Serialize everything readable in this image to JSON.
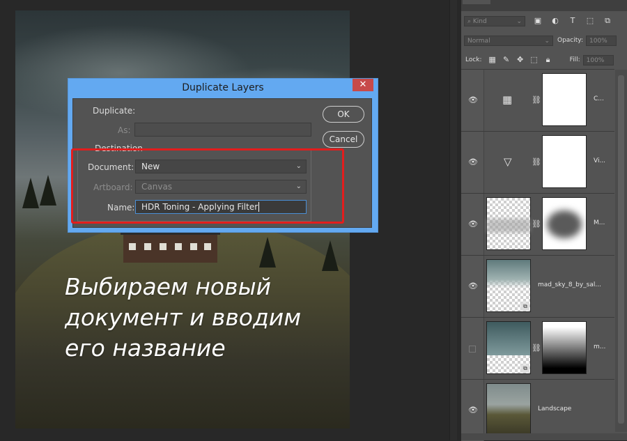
{
  "canvas": {
    "caption_lines": [
      "Выбираем новый",
      "документ и вводим",
      "его название"
    ]
  },
  "layers_panel": {
    "kind_filter": "Kind",
    "blend_mode": "Normal",
    "opacity_label": "Opacity:",
    "opacity_value": "100%",
    "lock_label": "Lock:",
    "fill_label": "Fill:",
    "fill_value": "100%",
    "layers": [
      {
        "name": "C...",
        "visible": true,
        "type": "channel-mixer-adjustment"
      },
      {
        "name": "Vi...",
        "visible": true,
        "type": "vibrance-adjustment"
      },
      {
        "name": "M...",
        "visible": true,
        "type": "masked-layer"
      },
      {
        "name": "mad_sky_8_by_sal...",
        "visible": true,
        "type": "smart-object"
      },
      {
        "name": "m...",
        "visible": false,
        "type": "smart-object-masked"
      },
      {
        "name": "Landscape",
        "visible": true,
        "type": "pixel-layer"
      }
    ]
  },
  "dialog": {
    "title": "Duplicate Layers",
    "close_label": "✕",
    "duplicate_label": "Duplicate:",
    "as_label": "As:",
    "as_value": "",
    "destination_label": "Destination",
    "document_label": "Document:",
    "document_value": "New",
    "artboard_label": "Artboard:",
    "artboard_value": "Canvas",
    "name_label": "Name:",
    "name_value": "HDR Toning - Applying Filter",
    "ok_label": "OK",
    "cancel_label": "Cancel"
  },
  "colors": {
    "dialog_title_bar": "#63a9f1",
    "highlight": "#e31d1d",
    "panel_bg": "#535353"
  }
}
